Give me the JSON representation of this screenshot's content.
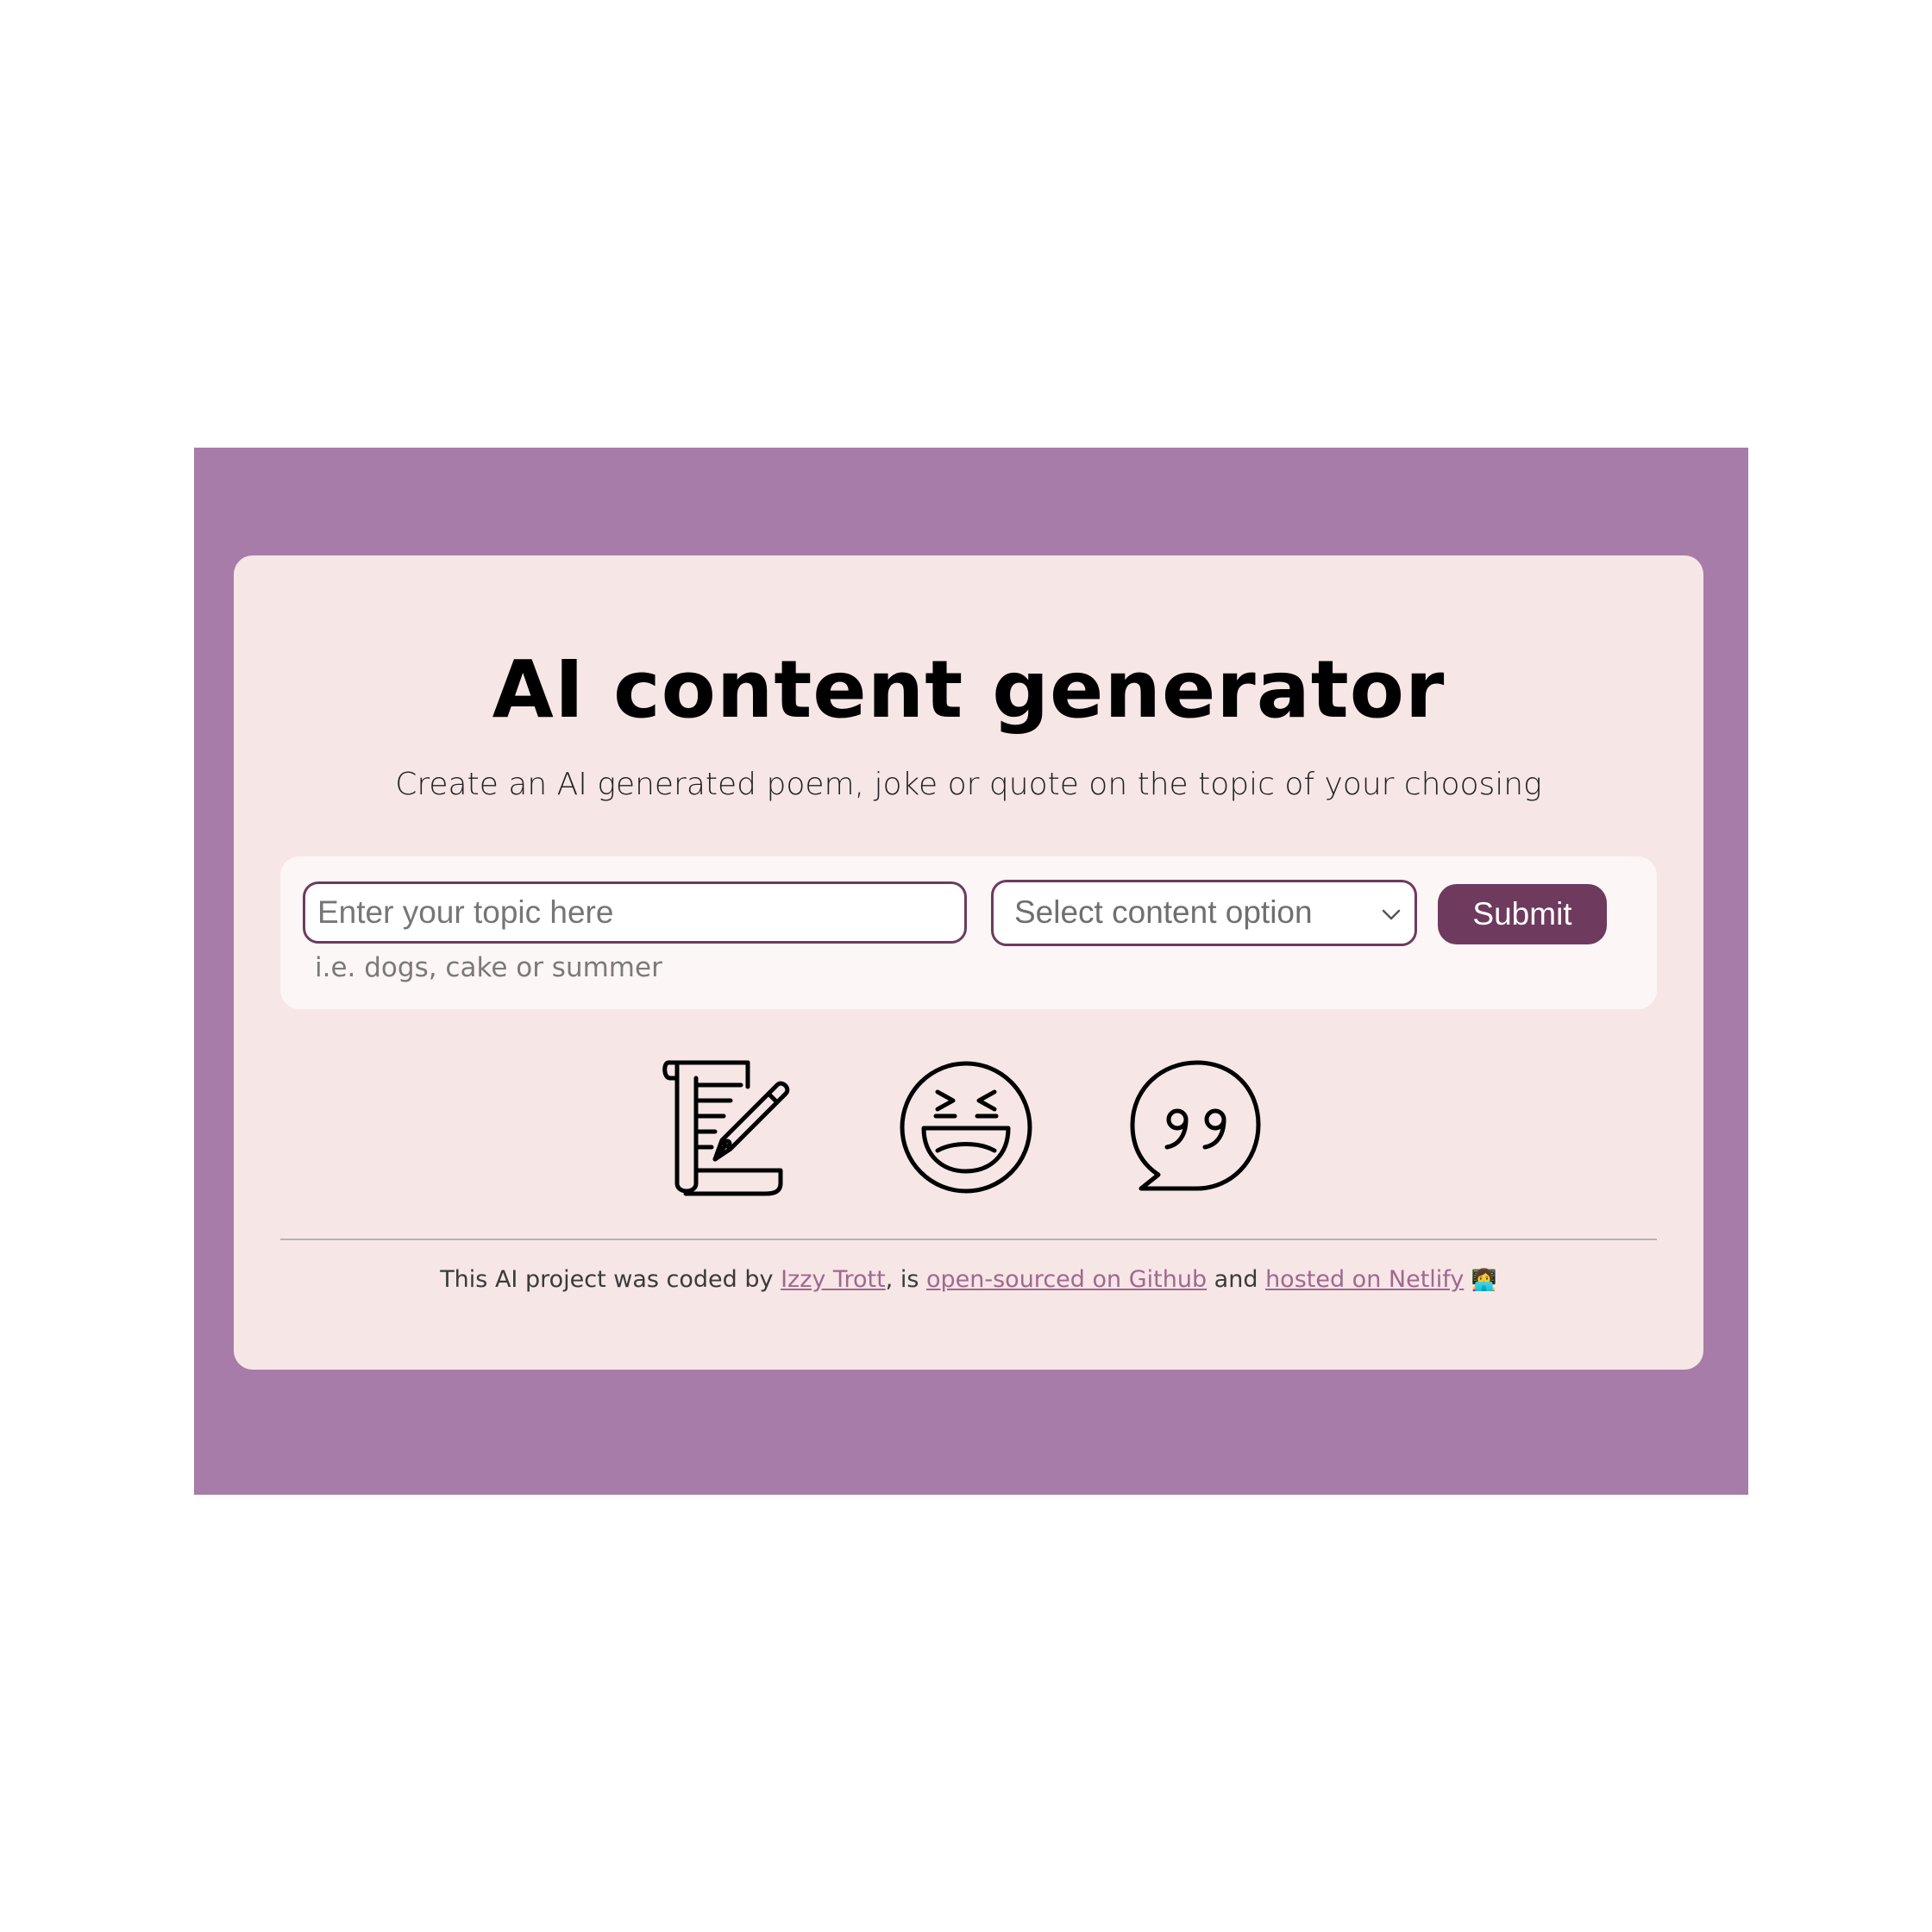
{
  "header": {
    "title": "AI content generator",
    "subtitle": "Create an AI generated poem, joke or quote on the topic of your choosing"
  },
  "form": {
    "topic_placeholder": "Enter your topic here",
    "hint": "i.e. dogs, cake or summer",
    "select_selected": "Select content option",
    "submit_label": "Submit"
  },
  "icons": [
    "poem-scroll-icon",
    "laughing-face-icon",
    "quote-bubble-icon"
  ],
  "footer": {
    "text_before": "This AI project was coded by ",
    "author_link": "Izzy Trott",
    "text_mid1": ", is ",
    "github_link": "open-sourced on Github",
    "text_mid2": " and ",
    "netlify_link": "hosted on Netlify",
    "emoji": "👩‍💻"
  },
  "colors": {
    "background": "#a77ca9",
    "card": "#f6e6e6",
    "panel": "#fdf6f6",
    "accent": "#6e3a5e",
    "link": "#a0688f"
  }
}
